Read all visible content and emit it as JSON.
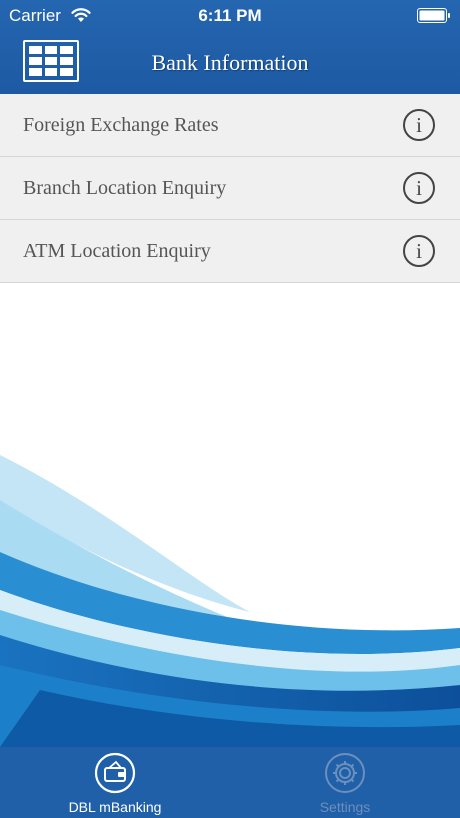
{
  "status_bar": {
    "carrier": "Carrier",
    "time": "6:11 PM"
  },
  "header": {
    "title": "Bank Information",
    "menu_icon": "grid-icon"
  },
  "menu": {
    "items": [
      {
        "label": "Foreign Exchange Rates",
        "icon": "info-icon"
      },
      {
        "label": "Branch Location Enquiry",
        "icon": "info-icon"
      },
      {
        "label": "ATM Location Enquiry",
        "icon": "info-icon"
      }
    ]
  },
  "tab_bar": {
    "tabs": [
      {
        "label": "DBL mBanking",
        "icon": "wallet-icon",
        "active": true
      },
      {
        "label": "Settings",
        "icon": "gear-icon",
        "active": false
      }
    ]
  },
  "colors": {
    "header": "#2566b0",
    "tab_bar": "#2060a8",
    "wave_dark": "#1565b4",
    "wave_light": "#8dd0f0"
  }
}
